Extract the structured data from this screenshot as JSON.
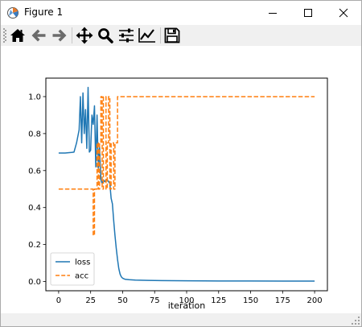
{
  "window": {
    "title": "Figure 1",
    "controls": [
      "minimize",
      "maximize",
      "close"
    ]
  },
  "toolbar": {
    "buttons": [
      {
        "name": "home",
        "icon": "home-icon"
      },
      {
        "name": "back",
        "icon": "arrow-left-icon"
      },
      {
        "name": "forward",
        "icon": "arrow-right-icon"
      },
      {
        "name": "pan",
        "icon": "move-icon"
      },
      {
        "name": "zoom",
        "icon": "zoom-icon"
      },
      {
        "name": "subplots",
        "icon": "sliders-icon"
      },
      {
        "name": "customize",
        "icon": "chart-line-icon"
      },
      {
        "name": "save",
        "icon": "floppy-icon"
      }
    ]
  },
  "colors": {
    "loss": "#1f77b4",
    "acc": "#ff7f0e",
    "toolbar_bg": "#f0f0f0"
  },
  "chart_data": {
    "type": "line",
    "xlabel": "iteration",
    "ylabel": "",
    "title": "",
    "xlim": [
      -10,
      210
    ],
    "ylim": [
      -0.05,
      1.1
    ],
    "xticks": [
      0,
      25,
      50,
      75,
      100,
      125,
      150,
      175,
      200
    ],
    "xtick_labels": [
      "0",
      "25",
      "50",
      "75",
      "100",
      "125",
      "150",
      "175",
      "200"
    ],
    "yticks": [
      0.0,
      0.2,
      0.4,
      0.6,
      0.8,
      1.0
    ],
    "ytick_labels": [
      "0.0",
      "0.2",
      "0.4",
      "0.6",
      "0.8",
      "1.0"
    ],
    "grid": false,
    "legend_position": "lower-left",
    "series": [
      {
        "name": "loss",
        "style": "solid",
        "x": [
          0,
          5,
          10,
          12,
          14,
          16,
          17,
          18,
          19,
          20,
          21,
          22,
          23,
          24,
          25,
          26,
          27,
          28,
          29,
          30,
          31,
          32,
          33,
          34,
          35,
          36,
          37,
          38,
          39,
          40,
          41,
          42,
          43,
          44,
          45,
          46,
          47,
          48,
          49,
          50,
          52,
          55,
          60,
          70,
          80,
          100,
          125,
          150,
          175,
          200
        ],
        "y": [
          0.695,
          0.695,
          0.698,
          0.7,
          0.75,
          0.82,
          1.0,
          0.75,
          1.02,
          0.8,
          0.93,
          0.72,
          1.05,
          0.7,
          0.71,
          0.9,
          0.85,
          0.95,
          0.62,
          0.9,
          0.6,
          0.73,
          0.55,
          0.53,
          0.55,
          0.54,
          0.55,
          0.55,
          0.54,
          0.53,
          0.45,
          0.42,
          0.33,
          0.25,
          0.18,
          0.12,
          0.07,
          0.04,
          0.025,
          0.018,
          0.012,
          0.01,
          0.008,
          0.006,
          0.005,
          0.004,
          0.003,
          0.003,
          0.002,
          0.002
        ]
      },
      {
        "name": "acc",
        "style": "dashed",
        "x": [
          0,
          27,
          27,
          28,
          28,
          30,
          30,
          31,
          31,
          32,
          32,
          33,
          33,
          34,
          34,
          35,
          35,
          37,
          37,
          38,
          38,
          39,
          39,
          40,
          40,
          41,
          41,
          43,
          43,
          44,
          44,
          46,
          46,
          200
        ],
        "y": [
          0.5,
          0.5,
          0.25,
          0.25,
          0.5,
          0.5,
          0.75,
          0.75,
          0.5,
          0.5,
          0.75,
          0.75,
          1.0,
          1.0,
          0.5,
          0.5,
          1.0,
          1.0,
          0.5,
          0.5,
          0.75,
          0.75,
          1.0,
          1.0,
          0.5,
          0.5,
          0.75,
          0.75,
          0.5,
          0.5,
          0.75,
          0.75,
          1.0,
          1.0
        ]
      }
    ]
  }
}
